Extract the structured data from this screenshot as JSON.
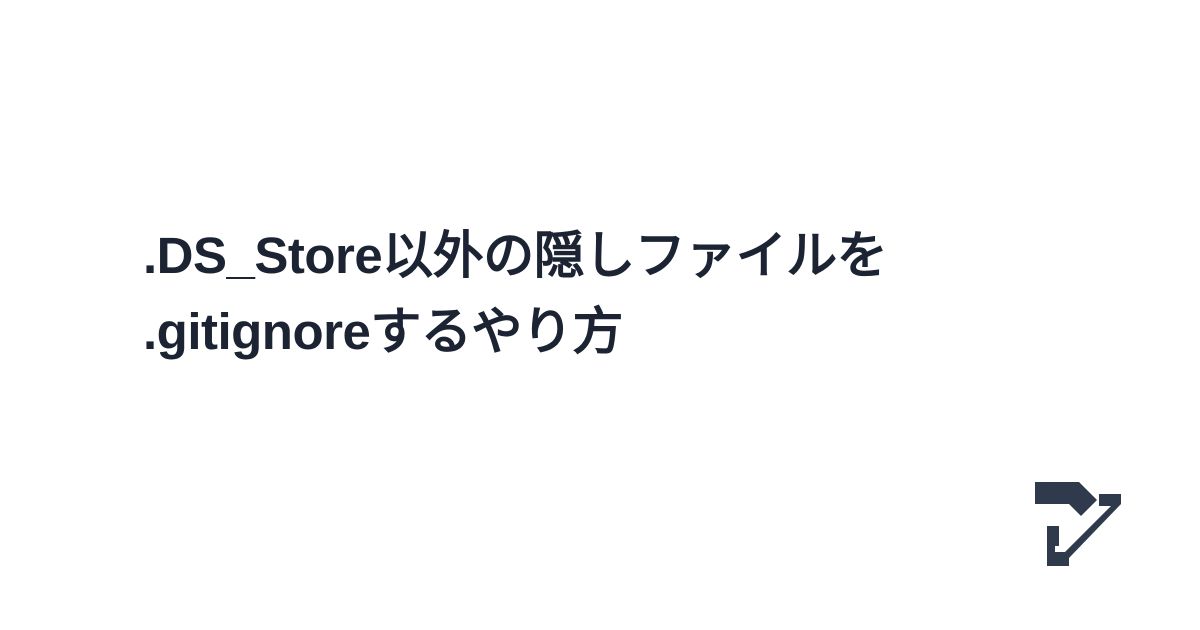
{
  "article": {
    "title_line_1": ".DS_Store以外の隠しファイルを",
    "title_line_2": ".gitignoreするやり方"
  },
  "logo": {
    "icon": "brand-logo-icon",
    "color": "#2f3a4d"
  },
  "theme": {
    "background": "#ffffff",
    "text": "#1c2433"
  }
}
